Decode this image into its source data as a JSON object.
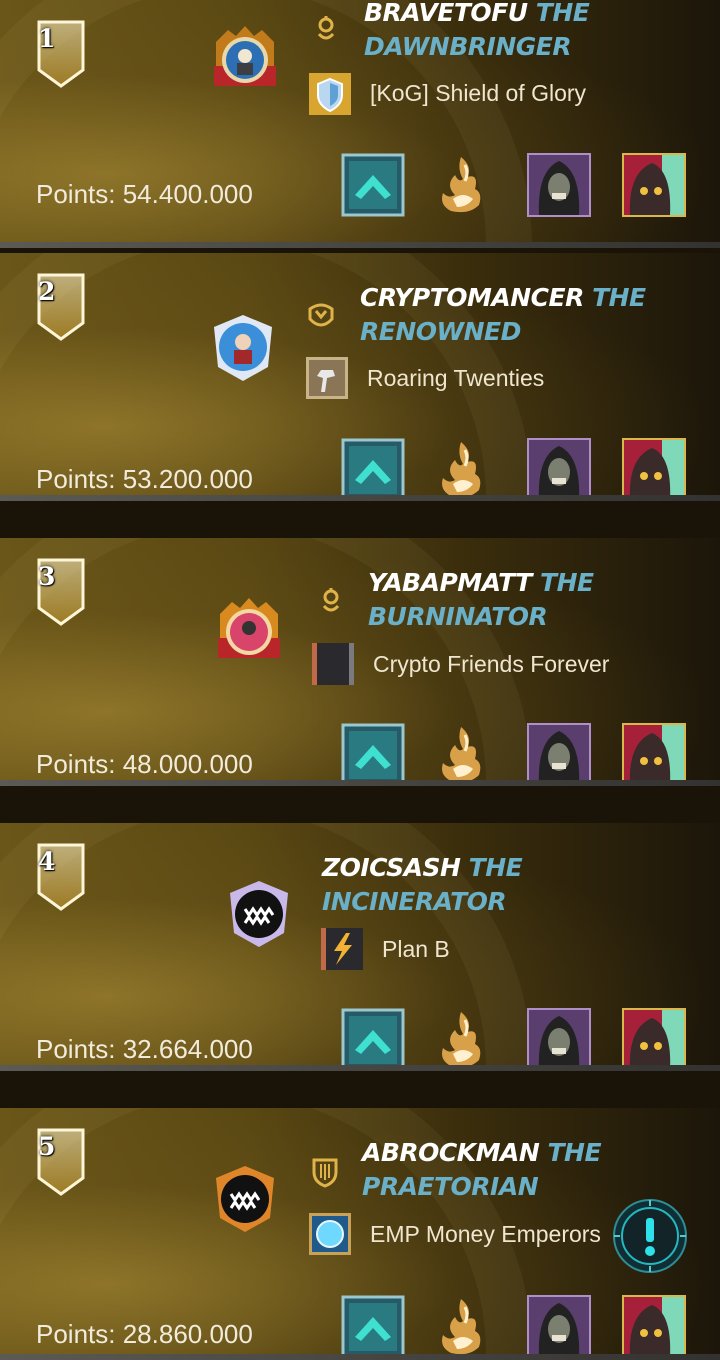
{
  "leaderboard": {
    "points_prefix": "Points: ",
    "rows": [
      {
        "rank": "1",
        "player": "BRAVETOFU",
        "title": "THE DAWNBRINGER",
        "title_line1": "THE",
        "title_line2": "DAWNBRINGER",
        "guild": "[KoG] Shield of Glory",
        "points": "54.400.000",
        "avatar_color": "#2d6fb5",
        "name_accent": "#69b0c8"
      },
      {
        "rank": "2",
        "player": "CRYPTOMANCER",
        "title": "THE RENOWNED",
        "title_line1": "THE",
        "title_line2": "RENOWNED",
        "guild": "Roaring Twenties",
        "points": "53.200.000",
        "avatar_color": "#3a8fd8",
        "name_accent": "#69b0c8"
      },
      {
        "rank": "3",
        "player": "YABAPMATT",
        "title": "THE BURNINATOR",
        "title_line1": "THE",
        "title_line2": "BURNINATOR",
        "guild": "Crypto Friends Forever",
        "points": "48.000.000",
        "avatar_color": "#d8446a",
        "name_accent": "#69b0c8"
      },
      {
        "rank": "4",
        "player": "ZOICSASH",
        "title": "THE INCINERATOR",
        "title_line1": "THE",
        "title_line2": "INCINERATOR",
        "guild": "Plan B",
        "points": "32.664.000",
        "avatar_color": "#c9b9ea",
        "name_accent": "#69b0c8"
      },
      {
        "rank": "5",
        "player": "ABROCKMAN",
        "title": "THE PRAETORIAN",
        "title_line1": "THE",
        "title_line2": "PRAETORIAN",
        "guild": "EMP Money Emperors",
        "points": "28.860.000",
        "avatar_color": "#e0862a",
        "name_accent": "#69b0c8"
      }
    ]
  },
  "icons": {
    "rank_badge": "rank-banner-icon",
    "league_card": "league-up-arrow-icon",
    "summoner_card": "fire-summoner-icon",
    "monster_card_1": "hooded-skull-monster-icon",
    "monster_card_2": "red-hood-monster-icon",
    "alert": "exclamation-icon"
  },
  "colors": {
    "title_accent": "#69b0c8",
    "card_teal": "#2fb3a8",
    "gold": "#d8b24a"
  }
}
